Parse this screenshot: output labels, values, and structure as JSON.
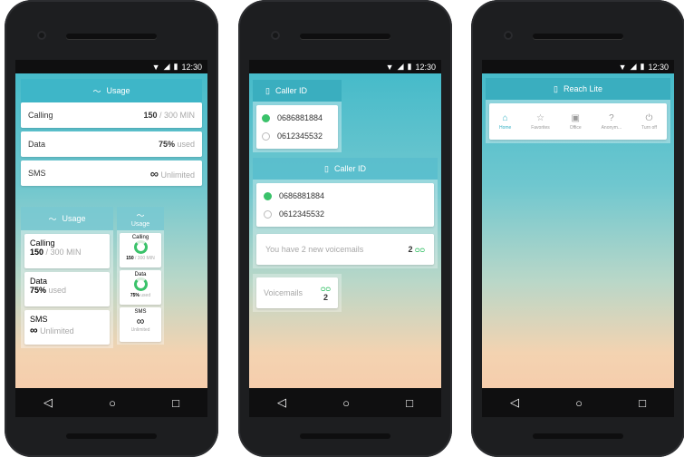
{
  "status": {
    "time": "12:30"
  },
  "phone1": {
    "header": "Usage",
    "calling": {
      "label": "Calling",
      "value": "150",
      "unit": "/ 300 MIN"
    },
    "data": {
      "label": "Data",
      "value": "75%",
      "unit": "used"
    },
    "sms": {
      "label": "SMS",
      "value": "Unlimited"
    },
    "panel2": {
      "header": "Usage",
      "calling": {
        "label": "Calling",
        "value": "150",
        "unit": "/ 300 MIN"
      },
      "data": {
        "label": "Data",
        "value": "75%",
        "unit": "used"
      },
      "sms": {
        "label": "SMS",
        "value": "Unlimited"
      }
    },
    "narrow": {
      "header": "Usage",
      "calling": {
        "label": "Calling",
        "value": "150",
        "unit": "/ 300 MIN"
      },
      "data": {
        "label": "Data",
        "value": "75%",
        "unit": "used"
      },
      "sms": {
        "label": "SMS",
        "value": "Unlimited"
      }
    }
  },
  "phone2": {
    "small_callerid": {
      "title": "Caller ID",
      "numbers": [
        "0686881884",
        "0612345532"
      ]
    },
    "wide_callerid": {
      "title": "Caller ID",
      "numbers": [
        "0686881884",
        "0612345532"
      ]
    },
    "voicemail_banner": {
      "text": "You have 2 new voicemails",
      "count": "2"
    },
    "voicemail_tile": {
      "label": "Voicemails",
      "count": "2"
    }
  },
  "phone3": {
    "title": "Reach Lite",
    "tabs": [
      {
        "label": "Home",
        "icon": "home-icon"
      },
      {
        "label": "Favorites",
        "icon": "star-icon"
      },
      {
        "label": "Office",
        "icon": "office-icon"
      },
      {
        "label": "Anonym...",
        "icon": "question-icon"
      },
      {
        "label": "Turn off",
        "icon": "power-icon"
      }
    ]
  },
  "colors": {
    "accent": "#3ac26a",
    "teal": "#3ab3c6"
  }
}
